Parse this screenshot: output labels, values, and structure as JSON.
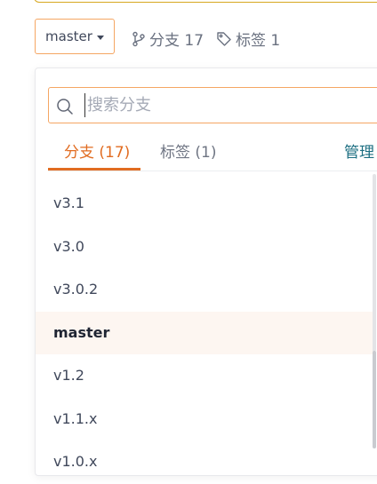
{
  "branch_selector": {
    "current": "master"
  },
  "repo_meta": {
    "branches_label": "分支 17",
    "tags_label": "标签 1"
  },
  "dropdown": {
    "search": {
      "placeholder": "搜索分支",
      "value": ""
    },
    "tabs": [
      {
        "label": "分支 (17)",
        "active": true
      },
      {
        "label": "标签 (1)",
        "active": false
      }
    ],
    "manage_label": "管理",
    "branches": [
      {
        "name": "v3.1",
        "active": false
      },
      {
        "name": "v3.0",
        "active": false
      },
      {
        "name": "v3.0.2",
        "active": false
      },
      {
        "name": "master",
        "active": true
      },
      {
        "name": "v1.2",
        "active": false
      },
      {
        "name": "v1.1.x",
        "active": false
      },
      {
        "name": "v1.0.x",
        "active": false
      }
    ]
  },
  "colors": {
    "accent": "#e16c21",
    "input_border": "#f5a663",
    "active_row_bg": "#fdf6f1",
    "link": "#1d6f82"
  },
  "icons": {
    "branch": "branch-icon",
    "tag": "tag-icon",
    "search": "search-icon",
    "dropdown": "caret-down-icon"
  }
}
